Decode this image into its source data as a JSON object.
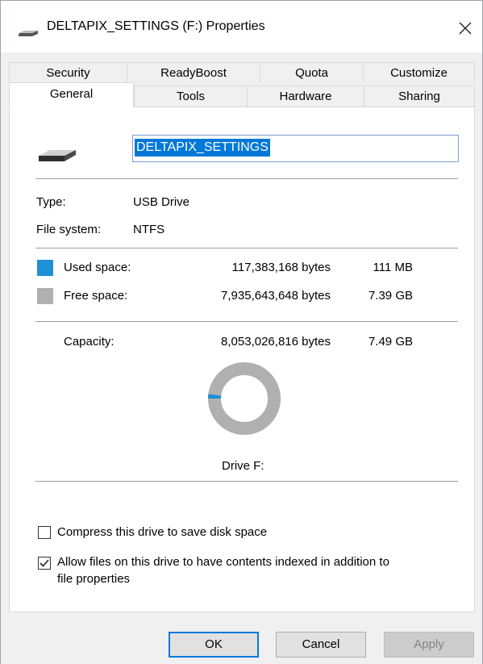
{
  "window": {
    "title": "DELTAPIX_SETTINGS (F:) Properties",
    "close_glyph": "✕"
  },
  "tabs": {
    "row1": [
      "Security",
      "ReadyBoost",
      "Quota",
      "Customize"
    ],
    "row2": [
      "General",
      "Tools",
      "Hardware",
      "Sharing"
    ],
    "selected": "General"
  },
  "general": {
    "drive_name": "DELTAPIX_SETTINGS",
    "type_label": "Type:",
    "type_value": "USB Drive",
    "fs_label": "File system:",
    "fs_value": "NTFS",
    "used": {
      "label": "Used space:",
      "bytes": "117,383,168 bytes",
      "size": "111 MB",
      "color": "#1e90d6"
    },
    "free": {
      "label": "Free space:",
      "bytes": "7,935,643,648 bytes",
      "size": "7.39 GB",
      "color": "#b0b0b0"
    },
    "capacity": {
      "label": "Capacity:",
      "bytes": "8,053,026,816 bytes",
      "size": "7.49 GB"
    },
    "used_fraction": 0.0146,
    "drive_caption": "Drive F:",
    "compress_label": "Compress this drive to save disk space",
    "compress_checked": false,
    "index_label_line1": "Allow files on this drive to have contents indexed in addition to",
    "index_label_line2": "file properties",
    "index_checked": true
  },
  "buttons": {
    "ok": "OK",
    "cancel": "Cancel",
    "apply": "Apply"
  }
}
